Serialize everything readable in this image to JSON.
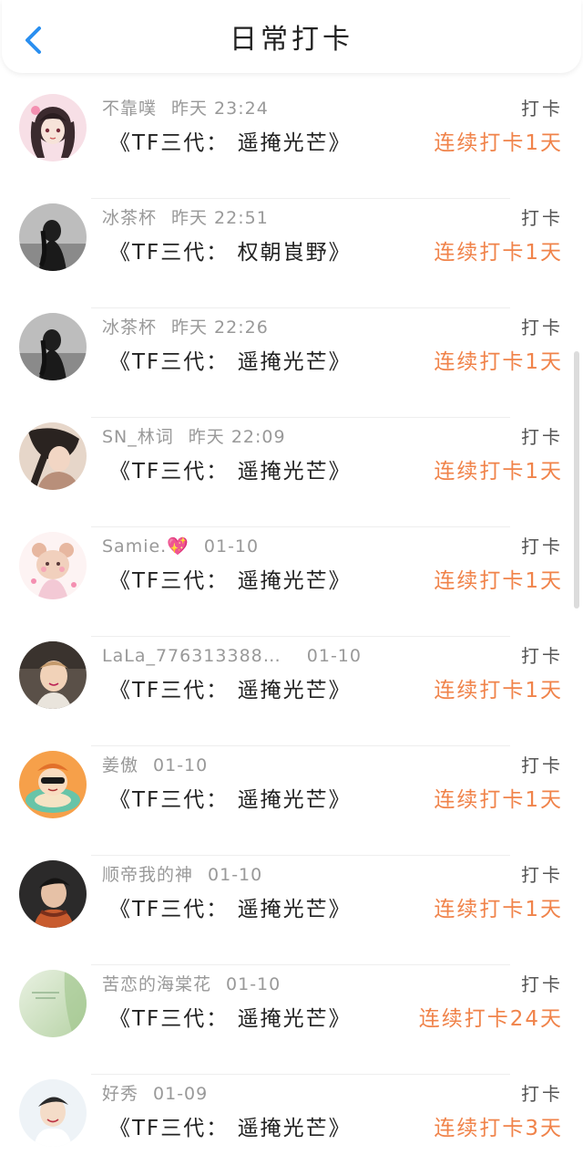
{
  "header": {
    "title": "日常打卡",
    "back_icon": "chevron-left-icon",
    "accent_color": "#2a8ff0"
  },
  "colors": {
    "streak": "#f0834a",
    "meta": "#999999",
    "text": "#222222"
  },
  "entries": [
    {
      "user": "不靠噗",
      "time": "昨天 23:24",
      "content": "《TF三代： 遥掩光芒》",
      "action": "打卡",
      "streak": "连续打卡1天",
      "avatar": "anime-girl-avatar"
    },
    {
      "user": "冰茶杯",
      "time": "昨天 22:51",
      "content": "《TF三代： 权朝崀野》",
      "action": "打卡",
      "streak": "连续打卡1天",
      "avatar": "dark-photo-avatar"
    },
    {
      "user": "冰茶杯",
      "time": "昨天 22:26",
      "content": "《TF三代： 遥掩光芒》",
      "action": "打卡",
      "streak": "连续打卡1天",
      "avatar": "dark-photo-avatar"
    },
    {
      "user": "SN_林词",
      "time": "昨天 22:09",
      "content": "《TF三代： 遥掩光芒》",
      "action": "打卡",
      "streak": "连续打卡1天",
      "avatar": "girl-photo-avatar"
    },
    {
      "user": "Samie.💖",
      "time": "01-10",
      "content": "《TF三代： 遥掩光芒》",
      "action": "打卡",
      "streak": "连续打卡1天",
      "avatar": "cartoon-bear-avatar"
    },
    {
      "user": "LaLa_776313388…",
      "time": "01-10",
      "content": "《TF三代： 遥掩光芒》",
      "action": "打卡",
      "streak": "连续打卡1天",
      "avatar": "child-photo-avatar"
    },
    {
      "user": "姜傲",
      "time": "01-10",
      "content": "《TF三代： 遥掩光芒》",
      "action": "打卡",
      "streak": "连续打卡1天",
      "avatar": "cartoon-character-avatar"
    },
    {
      "user": "顺帝我的神",
      "time": "01-10",
      "content": "《TF三代： 遥掩光芒》",
      "action": "打卡",
      "streak": "连续打卡1天",
      "avatar": "boy-photo-avatar"
    },
    {
      "user": "苦恋的海棠花",
      "time": "01-10",
      "content": "《TF三代： 遥掩光芒》",
      "action": "打卡",
      "streak": "连续打卡24天",
      "avatar": "green-gradient-avatar"
    },
    {
      "user": "好秀",
      "time": "01-09",
      "content": "《TF三代： 遥掩光芒》",
      "action": "打卡",
      "streak": "连续打卡3天",
      "avatar": "smiling-boy-avatar"
    }
  ]
}
